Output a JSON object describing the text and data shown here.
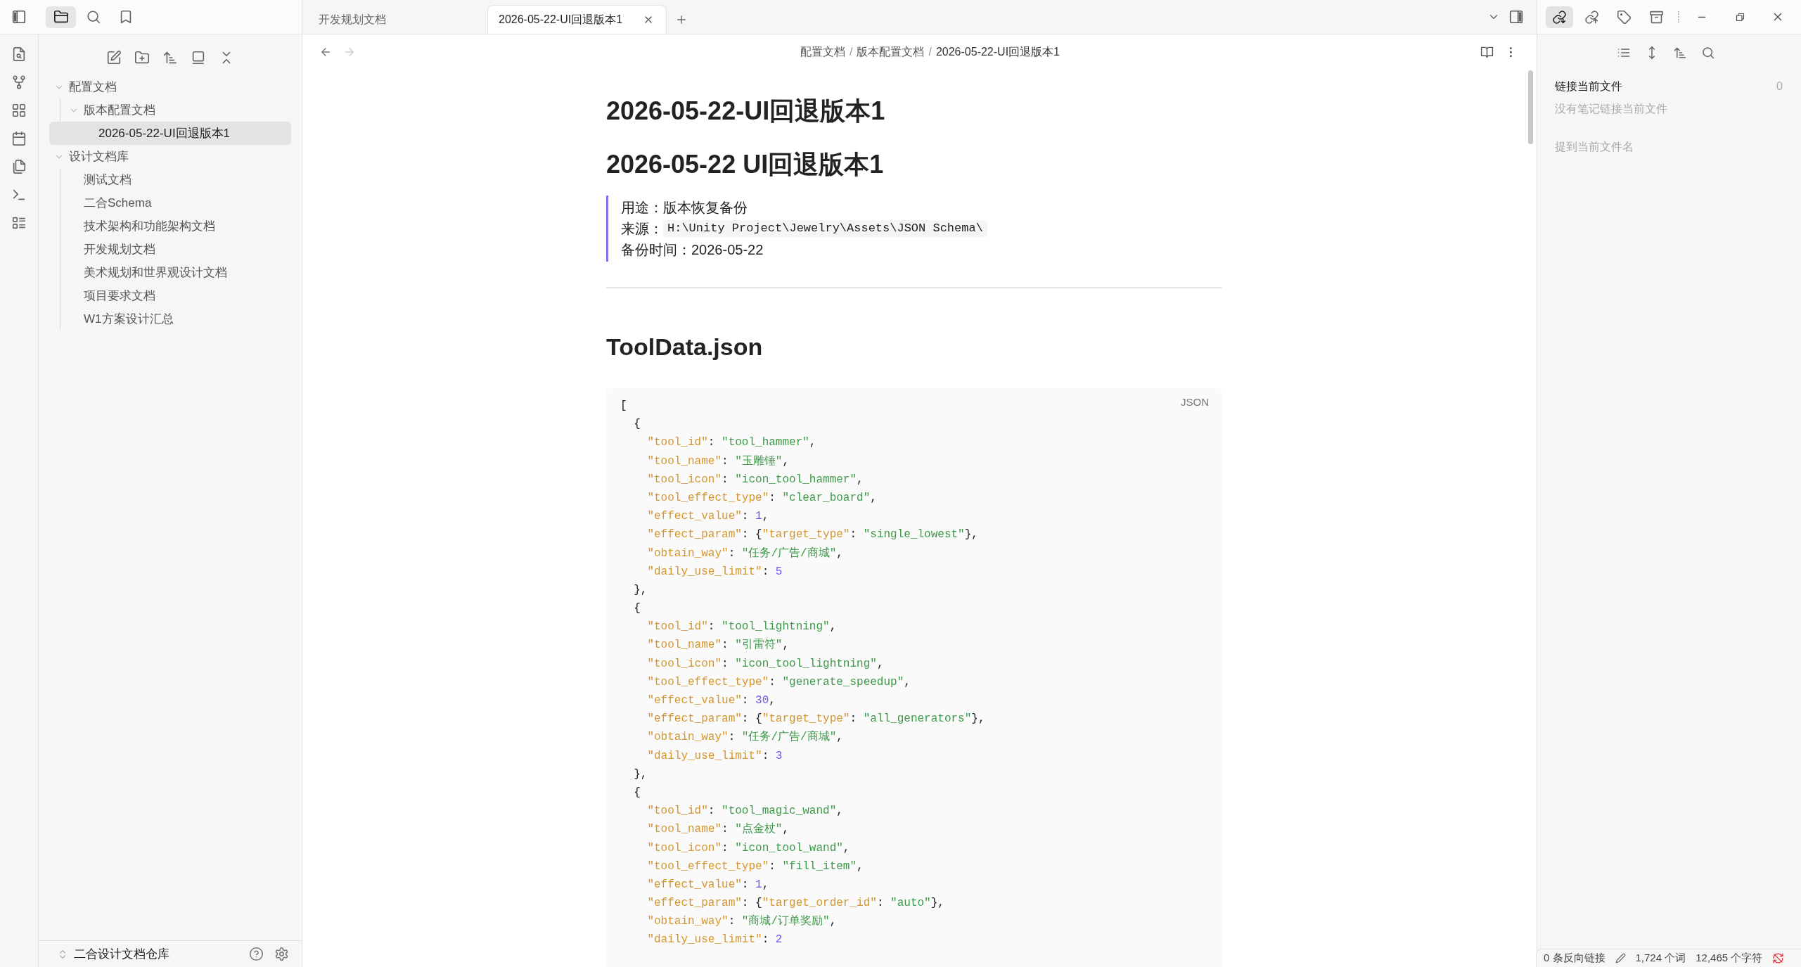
{
  "left_tabs": [
    {
      "kind": "files",
      "selected": true
    },
    {
      "kind": "search",
      "selected": false
    },
    {
      "kind": "bookmarks",
      "selected": false
    }
  ],
  "file_tree": [
    {
      "kind": "folder",
      "label": "配置文档",
      "expanded": true,
      "selected": false,
      "children": [
        {
          "kind": "folder",
          "label": "版本配置文档",
          "expanded": true,
          "selected": false,
          "children": [
            {
              "kind": "file",
              "label": "2026-05-22-UI回退版本1",
              "selected": true
            }
          ]
        }
      ]
    },
    {
      "kind": "folder",
      "label": "设计文档库",
      "expanded": true,
      "selected": false,
      "children": [
        {
          "kind": "file",
          "label": "测试文档",
          "selected": false
        },
        {
          "kind": "file",
          "label": "二合Schema",
          "selected": false
        },
        {
          "kind": "file",
          "label": "技术架构和功能架构文档",
          "selected": false
        },
        {
          "kind": "file",
          "label": "开发规划文档",
          "selected": false
        },
        {
          "kind": "file",
          "label": "美术规划和世界观设计文档",
          "selected": false
        },
        {
          "kind": "file",
          "label": "项目要求文档",
          "selected": false
        },
        {
          "kind": "file",
          "label": "W1方案设计汇总",
          "selected": false
        }
      ]
    }
  ],
  "vault_name": "二合设计文档仓库",
  "tabs": [
    {
      "label": "开发规划文档",
      "selected": false
    },
    {
      "label": "2026-05-22-UI回退版本1",
      "selected": true
    }
  ],
  "breadcrumb": [
    "配置文档",
    "版本配置文档",
    "2026-05-22-UI回退版本1"
  ],
  "breadcrumb_separator": "/",
  "note": {
    "title": "2026-05-22-UI回退版本1",
    "heading": "2026-05-22 UI回退版本1",
    "quote": [
      {
        "text": "用途：版本恢复备份"
      },
      {
        "text": "来源：",
        "code": "H:\\Unity Project\\Jewelry\\Assets\\JSON Schema\\"
      },
      {
        "text": "备份时间：2026-05-22"
      }
    ],
    "section": "ToolData.json",
    "code_language": "JSON",
    "code_lines": [
      [
        {
          "kind": "punct",
          "text": "["
        }
      ],
      [
        {
          "kind": "punct",
          "text": "  {"
        }
      ],
      [
        {
          "kind": "key",
          "text": "    \"tool_id\""
        },
        {
          "kind": "punct",
          "text": ": "
        },
        {
          "kind": "string",
          "text": "\"tool_hammer\""
        },
        {
          "kind": "punct",
          "text": ","
        }
      ],
      [
        {
          "kind": "key",
          "text": "    \"tool_name\""
        },
        {
          "kind": "punct",
          "text": ": "
        },
        {
          "kind": "string",
          "text": "\"玉雕锤\""
        },
        {
          "kind": "punct",
          "text": ","
        }
      ],
      [
        {
          "kind": "key",
          "text": "    \"tool_icon\""
        },
        {
          "kind": "punct",
          "text": ": "
        },
        {
          "kind": "string",
          "text": "\"icon_tool_hammer\""
        },
        {
          "kind": "punct",
          "text": ","
        }
      ],
      [
        {
          "kind": "key",
          "text": "    \"tool_effect_type\""
        },
        {
          "kind": "punct",
          "text": ": "
        },
        {
          "kind": "string",
          "text": "\"clear_board\""
        },
        {
          "kind": "punct",
          "text": ","
        }
      ],
      [
        {
          "kind": "key",
          "text": "    \"effect_value\""
        },
        {
          "kind": "punct",
          "text": ": "
        },
        {
          "kind": "number",
          "text": "1"
        },
        {
          "kind": "punct",
          "text": ","
        }
      ],
      [
        {
          "kind": "key",
          "text": "    \"effect_param\""
        },
        {
          "kind": "punct",
          "text": ": {"
        },
        {
          "kind": "key",
          "text": "\"target_type\""
        },
        {
          "kind": "punct",
          "text": ": "
        },
        {
          "kind": "string",
          "text": "\"single_lowest\""
        },
        {
          "kind": "punct",
          "text": "},"
        }
      ],
      [
        {
          "kind": "key",
          "text": "    \"obtain_way\""
        },
        {
          "kind": "punct",
          "text": ": "
        },
        {
          "kind": "string",
          "text": "\"任务/广告/商城\""
        },
        {
          "kind": "punct",
          "text": ","
        }
      ],
      [
        {
          "kind": "key",
          "text": "    \"daily_use_limit\""
        },
        {
          "kind": "punct",
          "text": ": "
        },
        {
          "kind": "number",
          "text": "5"
        }
      ],
      [
        {
          "kind": "punct",
          "text": "  },"
        }
      ],
      [
        {
          "kind": "punct",
          "text": "  {"
        }
      ],
      [
        {
          "kind": "key",
          "text": "    \"tool_id\""
        },
        {
          "kind": "punct",
          "text": ": "
        },
        {
          "kind": "string",
          "text": "\"tool_lightning\""
        },
        {
          "kind": "punct",
          "text": ","
        }
      ],
      [
        {
          "kind": "key",
          "text": "    \"tool_name\""
        },
        {
          "kind": "punct",
          "text": ": "
        },
        {
          "kind": "string",
          "text": "\"引雷符\""
        },
        {
          "kind": "punct",
          "text": ","
        }
      ],
      [
        {
          "kind": "key",
          "text": "    \"tool_icon\""
        },
        {
          "kind": "punct",
          "text": ": "
        },
        {
          "kind": "string",
          "text": "\"icon_tool_lightning\""
        },
        {
          "kind": "punct",
          "text": ","
        }
      ],
      [
        {
          "kind": "key",
          "text": "    \"tool_effect_type\""
        },
        {
          "kind": "punct",
          "text": ": "
        },
        {
          "kind": "string",
          "text": "\"generate_speedup\""
        },
        {
          "kind": "punct",
          "text": ","
        }
      ],
      [
        {
          "kind": "key",
          "text": "    \"effect_value\""
        },
        {
          "kind": "punct",
          "text": ": "
        },
        {
          "kind": "number",
          "text": "30"
        },
        {
          "kind": "punct",
          "text": ","
        }
      ],
      [
        {
          "kind": "key",
          "text": "    \"effect_param\""
        },
        {
          "kind": "punct",
          "text": ": {"
        },
        {
          "kind": "key",
          "text": "\"target_type\""
        },
        {
          "kind": "punct",
          "text": ": "
        },
        {
          "kind": "string",
          "text": "\"all_generators\""
        },
        {
          "kind": "punct",
          "text": "},"
        }
      ],
      [
        {
          "kind": "key",
          "text": "    \"obtain_way\""
        },
        {
          "kind": "punct",
          "text": ": "
        },
        {
          "kind": "string",
          "text": "\"任务/广告/商城\""
        },
        {
          "kind": "punct",
          "text": ","
        }
      ],
      [
        {
          "kind": "key",
          "text": "    \"daily_use_limit\""
        },
        {
          "kind": "punct",
          "text": ": "
        },
        {
          "kind": "number",
          "text": "3"
        }
      ],
      [
        {
          "kind": "punct",
          "text": "  },"
        }
      ],
      [
        {
          "kind": "punct",
          "text": "  {"
        }
      ],
      [
        {
          "kind": "key",
          "text": "    \"tool_id\""
        },
        {
          "kind": "punct",
          "text": ": "
        },
        {
          "kind": "string",
          "text": "\"tool_magic_wand\""
        },
        {
          "kind": "punct",
          "text": ","
        }
      ],
      [
        {
          "kind": "key",
          "text": "    \"tool_name\""
        },
        {
          "kind": "punct",
          "text": ": "
        },
        {
          "kind": "string",
          "text": "\"点金杖\""
        },
        {
          "kind": "punct",
          "text": ","
        }
      ],
      [
        {
          "kind": "key",
          "text": "    \"tool_icon\""
        },
        {
          "kind": "punct",
          "text": ": "
        },
        {
          "kind": "string",
          "text": "\"icon_tool_wand\""
        },
        {
          "kind": "punct",
          "text": ","
        }
      ],
      [
        {
          "kind": "key",
          "text": "    \"tool_effect_type\""
        },
        {
          "kind": "punct",
          "text": ": "
        },
        {
          "kind": "string",
          "text": "\"fill_item\""
        },
        {
          "kind": "punct",
          "text": ","
        }
      ],
      [
        {
          "kind": "key",
          "text": "    \"effect_value\""
        },
        {
          "kind": "punct",
          "text": ": "
        },
        {
          "kind": "number",
          "text": "1"
        },
        {
          "kind": "punct",
          "text": ","
        }
      ],
      [
        {
          "kind": "key",
          "text": "    \"effect_param\""
        },
        {
          "kind": "punct",
          "text": ": {"
        },
        {
          "kind": "key",
          "text": "\"target_order_id\""
        },
        {
          "kind": "punct",
          "text": ": "
        },
        {
          "kind": "string",
          "text": "\"auto\""
        },
        {
          "kind": "punct",
          "text": "},"
        }
      ],
      [
        {
          "kind": "key",
          "text": "    \"obtain_way\""
        },
        {
          "kind": "punct",
          "text": ": "
        },
        {
          "kind": "string",
          "text": "\"商城/订单奖励\""
        },
        {
          "kind": "punct",
          "text": ","
        }
      ],
      [
        {
          "kind": "key",
          "text": "    \"daily_use_limit\""
        },
        {
          "kind": "punct",
          "text": ": "
        },
        {
          "kind": "number",
          "text": "2"
        }
      ]
    ]
  },
  "right_tabs": [
    {
      "kind": "backlinks",
      "selected": true
    },
    {
      "kind": "outgoing_links",
      "selected": false
    },
    {
      "kind": "tags",
      "selected": false
    },
    {
      "kind": "archive",
      "selected": false
    }
  ],
  "backlinks": {
    "linked_title": "链接当前文件",
    "linked_count": "0",
    "linked_empty": "没有笔记链接当前文件",
    "unlinked_title": "提到当前文件名"
  },
  "status_bar": {
    "backlinks": "0 条反向链接",
    "words": "1,724 个词",
    "characters": "12,465 个字符"
  }
}
